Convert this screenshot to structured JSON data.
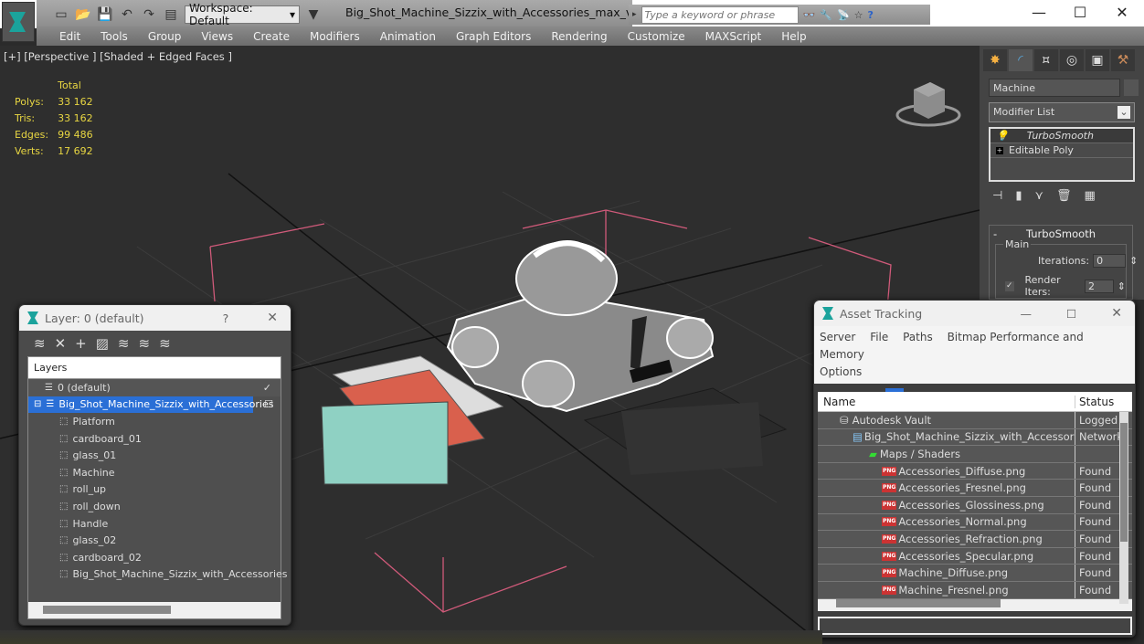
{
  "titlebar": {
    "workspace": "Workspace: Default",
    "document_title": "Big_Shot_Machine_Sizzix_with_Accessories_max_vray.max",
    "search_placeholder": "Type a keyword or phrase",
    "icons": [
      "new-file-icon",
      "open-folder-icon",
      "save-icon",
      "undo-icon",
      "redo-icon",
      "project-icon"
    ],
    "search_icons": [
      "binoculars-icon",
      "key-icon",
      "satellite-icon",
      "star-icon",
      "help-icon"
    ]
  },
  "menubar": [
    "Edit",
    "Tools",
    "Group",
    "Views",
    "Create",
    "Modifiers",
    "Animation",
    "Graph Editors",
    "Rendering",
    "Customize",
    "MAXScript",
    "Help"
  ],
  "viewport": {
    "label": "[+] [Perspective ] [Shaded + Edged Faces ]",
    "stats": {
      "header": "Total",
      "rows": [
        {
          "label": "Polys:",
          "value": "33 162"
        },
        {
          "label": "Tris:",
          "value": "33 162"
        },
        {
          "label": "Edges:",
          "value": "99 486"
        },
        {
          "label": "Verts:",
          "value": "17 692"
        }
      ]
    }
  },
  "command_panel": {
    "object_name": "Machine",
    "modifier_list": "Modifier List",
    "stack": [
      "TurboSmooth",
      "Editable Poly"
    ],
    "rollout": {
      "title": "TurboSmooth",
      "collapse": "-",
      "group": "Main",
      "iterations_label": "Iterations:",
      "iterations_value": "0",
      "render_iters_label": "Render Iters:",
      "render_iters_value": "2",
      "render_iters_checked": true
    }
  },
  "layer_dialog": {
    "title": "Layer: 0 (default)",
    "help": "?",
    "close": "✕",
    "column_header": "Layers",
    "default_layer": "0 (default)",
    "selected_layer": "Big_Shot_Machine_Sizzix_with_Accessories",
    "objects": [
      "Platform",
      "cardboard_01",
      "glass_01",
      "Machine",
      "roll_up",
      "roll_down",
      "Handle",
      "glass_02",
      "cardboard_02",
      "Big_Shot_Machine_Sizzix_with_Accessories"
    ]
  },
  "asset_tracking": {
    "title": "Asset Tracking",
    "menu": [
      "Server",
      "File",
      "Paths",
      "Bitmap Performance and Memory",
      "Options"
    ],
    "columns": [
      "Name",
      "Status"
    ],
    "rows": [
      {
        "name": "Autodesk Vault",
        "status": "Logged",
        "level": 1,
        "icon": "vault-icon"
      },
      {
        "name": "Big_Shot_Machine_Sizzix_with_Accessories...",
        "status": "Network",
        "level": 2,
        "icon": "max-file-icon"
      },
      {
        "name": "Maps / Shaders",
        "status": "",
        "level": 3,
        "icon": "maps-icon"
      },
      {
        "name": "Accessories_Diffuse.png",
        "status": "Found",
        "level": 4,
        "icon": "png-icon"
      },
      {
        "name": "Accessories_Fresnel.png",
        "status": "Found",
        "level": 4,
        "icon": "png-icon"
      },
      {
        "name": "Accessories_Glossiness.png",
        "status": "Found",
        "level": 4,
        "icon": "png-icon"
      },
      {
        "name": "Accessories_Normal.png",
        "status": "Found",
        "level": 4,
        "icon": "png-icon"
      },
      {
        "name": "Accessories_Refraction.png",
        "status": "Found",
        "level": 4,
        "icon": "png-icon"
      },
      {
        "name": "Accessories_Specular.png",
        "status": "Found",
        "level": 4,
        "icon": "png-icon"
      },
      {
        "name": "Machine_Diffuse.png",
        "status": "Found",
        "level": 4,
        "icon": "png-icon"
      },
      {
        "name": "Machine_Fresnel.png",
        "status": "Found",
        "level": 4,
        "icon": "png-icon"
      }
    ]
  }
}
